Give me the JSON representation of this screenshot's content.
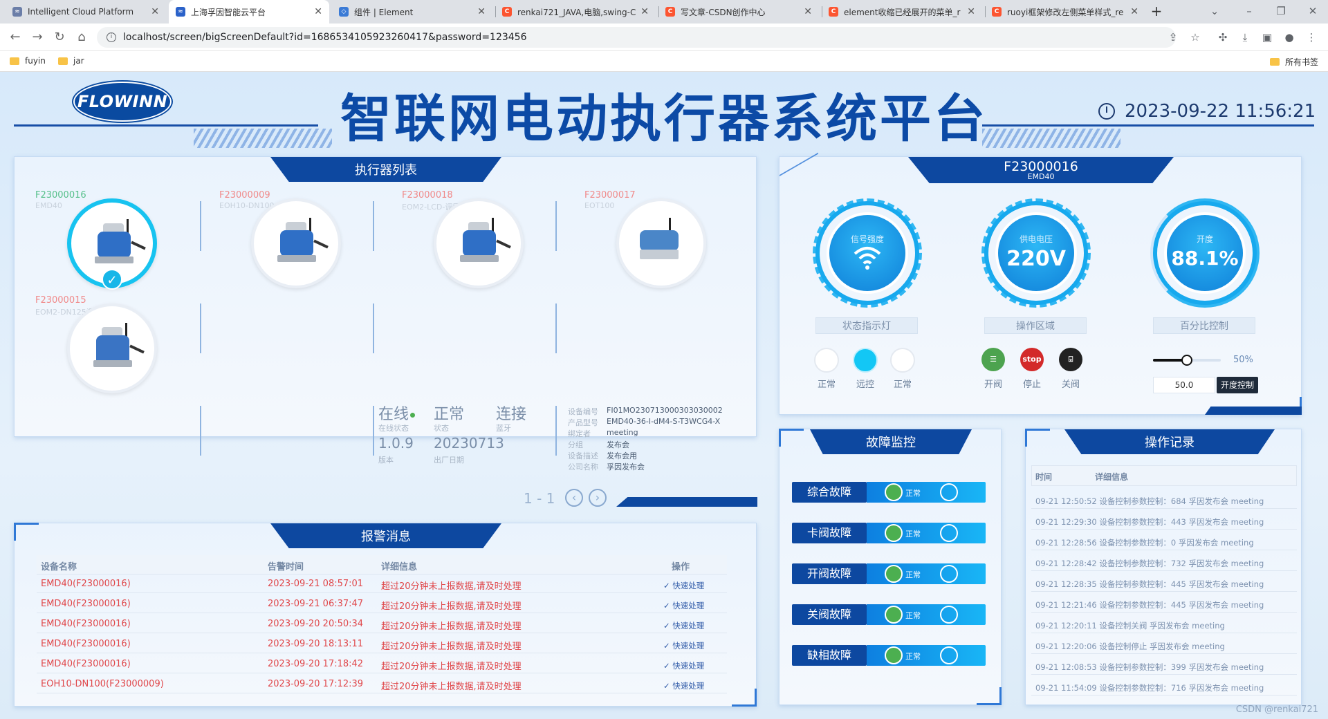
{
  "browser": {
    "tabs": [
      {
        "title": "Intelligent Cloud Platform",
        "icon": "cloud-icon"
      },
      {
        "title": "上海孚因智能云平台",
        "icon": "cloud-icon"
      },
      {
        "title": "组件 | Element",
        "icon": "element-icon"
      },
      {
        "title": "renkai721_JAVA,电脑,swing-C",
        "icon": "csdn-icon"
      },
      {
        "title": "写文章-CSDN创作中心",
        "icon": "csdn-icon"
      },
      {
        "title": "element收缩已经展开的菜单_r",
        "icon": "csdn-icon"
      },
      {
        "title": "ruoyi框架修改左侧菜单样式_re",
        "icon": "csdn-icon"
      }
    ],
    "url": "localhost/screen/bigScreenDefault?id=1686534105923260417&password=123456",
    "bookmarks": [
      "fuyin",
      "jar"
    ],
    "bookmarks_right": "所有书签",
    "colors": {
      "csdn": "#fc5531",
      "tabbar": "#dee1e6"
    }
  },
  "header": {
    "logo": "FLOWINN",
    "title": "智联网电动执行器系统平台",
    "datetime": "2023-09-22 11:56:21"
  },
  "executors": {
    "title": "执行器列表",
    "devices": [
      {
        "code": "F23000016",
        "model": "EMD40",
        "selected": true,
        "online": true
      },
      {
        "code": "F23000009",
        "model": "EOH10-DN100",
        "selected": false,
        "online": false
      },
      {
        "code": "F23000018",
        "model": "EOM2-LCD-调压通",
        "selected": false,
        "online": false
      },
      {
        "code": "F23000017",
        "model": "EOT100",
        "selected": false,
        "online": false
      },
      {
        "code": "F23000015",
        "model": "EOM2-DN125调节",
        "selected": false,
        "online": false
      }
    ],
    "status": {
      "online": "在线",
      "online_label": "在线状态",
      "state": "正常",
      "state_label": "状态",
      "conn": "连接",
      "conn_label": "蓝牙",
      "version": "1.0.9",
      "version_label": "版本",
      "date": "20230713",
      "date_label": "出厂日期"
    },
    "info": [
      {
        "k": "设备编号",
        "v": "FI01MO230713000303030002"
      },
      {
        "k": "产品型号",
        "v": "EMD40-36-I-dM4-S-T3WCG4-X"
      },
      {
        "k": "绑定者",
        "v": "meeting"
      },
      {
        "k": "分组",
        "v": "发布会"
      },
      {
        "k": "设备描述",
        "v": "发布会用"
      },
      {
        "k": "公司名称",
        "v": "孚因发布会"
      }
    ],
    "pager": "1 - 1"
  },
  "device_panel": {
    "code": "F23000016",
    "model": "EMD40",
    "gauges": [
      {
        "label": "信号强度",
        "value": ""
      },
      {
        "label": "供电电压",
        "value": "220V"
      },
      {
        "label": "开度",
        "value": "88.1%"
      }
    ],
    "sections": [
      "状态指示灯",
      "操作区域",
      "百分比控制"
    ],
    "lamps": [
      {
        "label": "正常",
        "on": false
      },
      {
        "label": "远控",
        "on": true
      },
      {
        "label": "正常",
        "on": false
      }
    ],
    "ops": [
      {
        "label": "开阀",
        "icon": "open-valve-icon"
      },
      {
        "label": "停止",
        "icon": "stop-icon",
        "badge": "stop"
      },
      {
        "label": "关阀",
        "icon": "close-valve-icon"
      }
    ],
    "percent": {
      "display": "50%",
      "value": 0.5,
      "input": "50.0",
      "button": "开度控制"
    }
  },
  "faults": {
    "title": "故障监控",
    "items": [
      {
        "label": "综合故障",
        "status": "正常"
      },
      {
        "label": "卡阀故障",
        "status": "正常"
      },
      {
        "label": "开阀故障",
        "status": "正常"
      },
      {
        "label": "关阀故障",
        "status": "正常"
      },
      {
        "label": "缺相故障",
        "status": "正常"
      }
    ]
  },
  "oplog": {
    "title": "操作记录",
    "headers": [
      "时间",
      "详细信息"
    ],
    "rows": [
      "09-21 12:50:52 设备控制参数控制：684 孚因发布会 meeting",
      "09-21 12:29:30 设备控制参数控制：443 孚因发布会 meeting",
      "09-21 12:28:56 设备控制参数控制：0 孚因发布会 meeting",
      "09-21 12:28:42 设备控制参数控制：732 孚因发布会 meeting",
      "09-21 12:28:35 设备控制参数控制：445 孚因发布会 meeting",
      "09-21 12:21:46 设备控制参数控制：445 孚因发布会 meeting",
      "09-21 12:20:11 设备控制关阀 孚因发布会 meeting",
      "09-21 12:20:06 设备控制停止 孚因发布会 meeting",
      "09-21 12:08:53 设备控制参数控制：399 孚因发布会 meeting",
      "09-21 11:54:09 设备控制参数控制：716 孚因发布会 meeting"
    ]
  },
  "alarms": {
    "title": "报警消息",
    "headers": [
      "设备名称",
      "告警时间",
      "详细信息",
      "操作"
    ],
    "rows": [
      {
        "name": "EMD40(F23000016)",
        "time": "2023-09-21 08:57:01",
        "detail": "超过20分钟未上报数据,请及时处理",
        "action": "✓ 快速处理"
      },
      {
        "name": "EMD40(F23000016)",
        "time": "2023-09-21 06:37:47",
        "detail": "超过20分钟未上报数据,请及时处理",
        "action": "✓ 快速处理"
      },
      {
        "name": "EMD40(F23000016)",
        "time": "2023-09-20 20:50:34",
        "detail": "超过20分钟未上报数据,请及时处理",
        "action": "✓ 快速处理"
      },
      {
        "name": "EMD40(F23000016)",
        "time": "2023-09-20 18:13:11",
        "detail": "超过20分钟未上报数据,请及时处理",
        "action": "✓ 快速处理"
      },
      {
        "name": "EMD40(F23000016)",
        "time": "2023-09-20 17:18:42",
        "detail": "超过20分钟未上报数据,请及时处理",
        "action": "✓ 快速处理"
      },
      {
        "name": "EOH10-DN100(F23000009)",
        "time": "2023-09-20 17:12:39",
        "detail": "超过20分钟未上报数据,请及时处理",
        "action": "✓ 快速处理"
      }
    ]
  },
  "watermark": "CSDN @renkai721"
}
